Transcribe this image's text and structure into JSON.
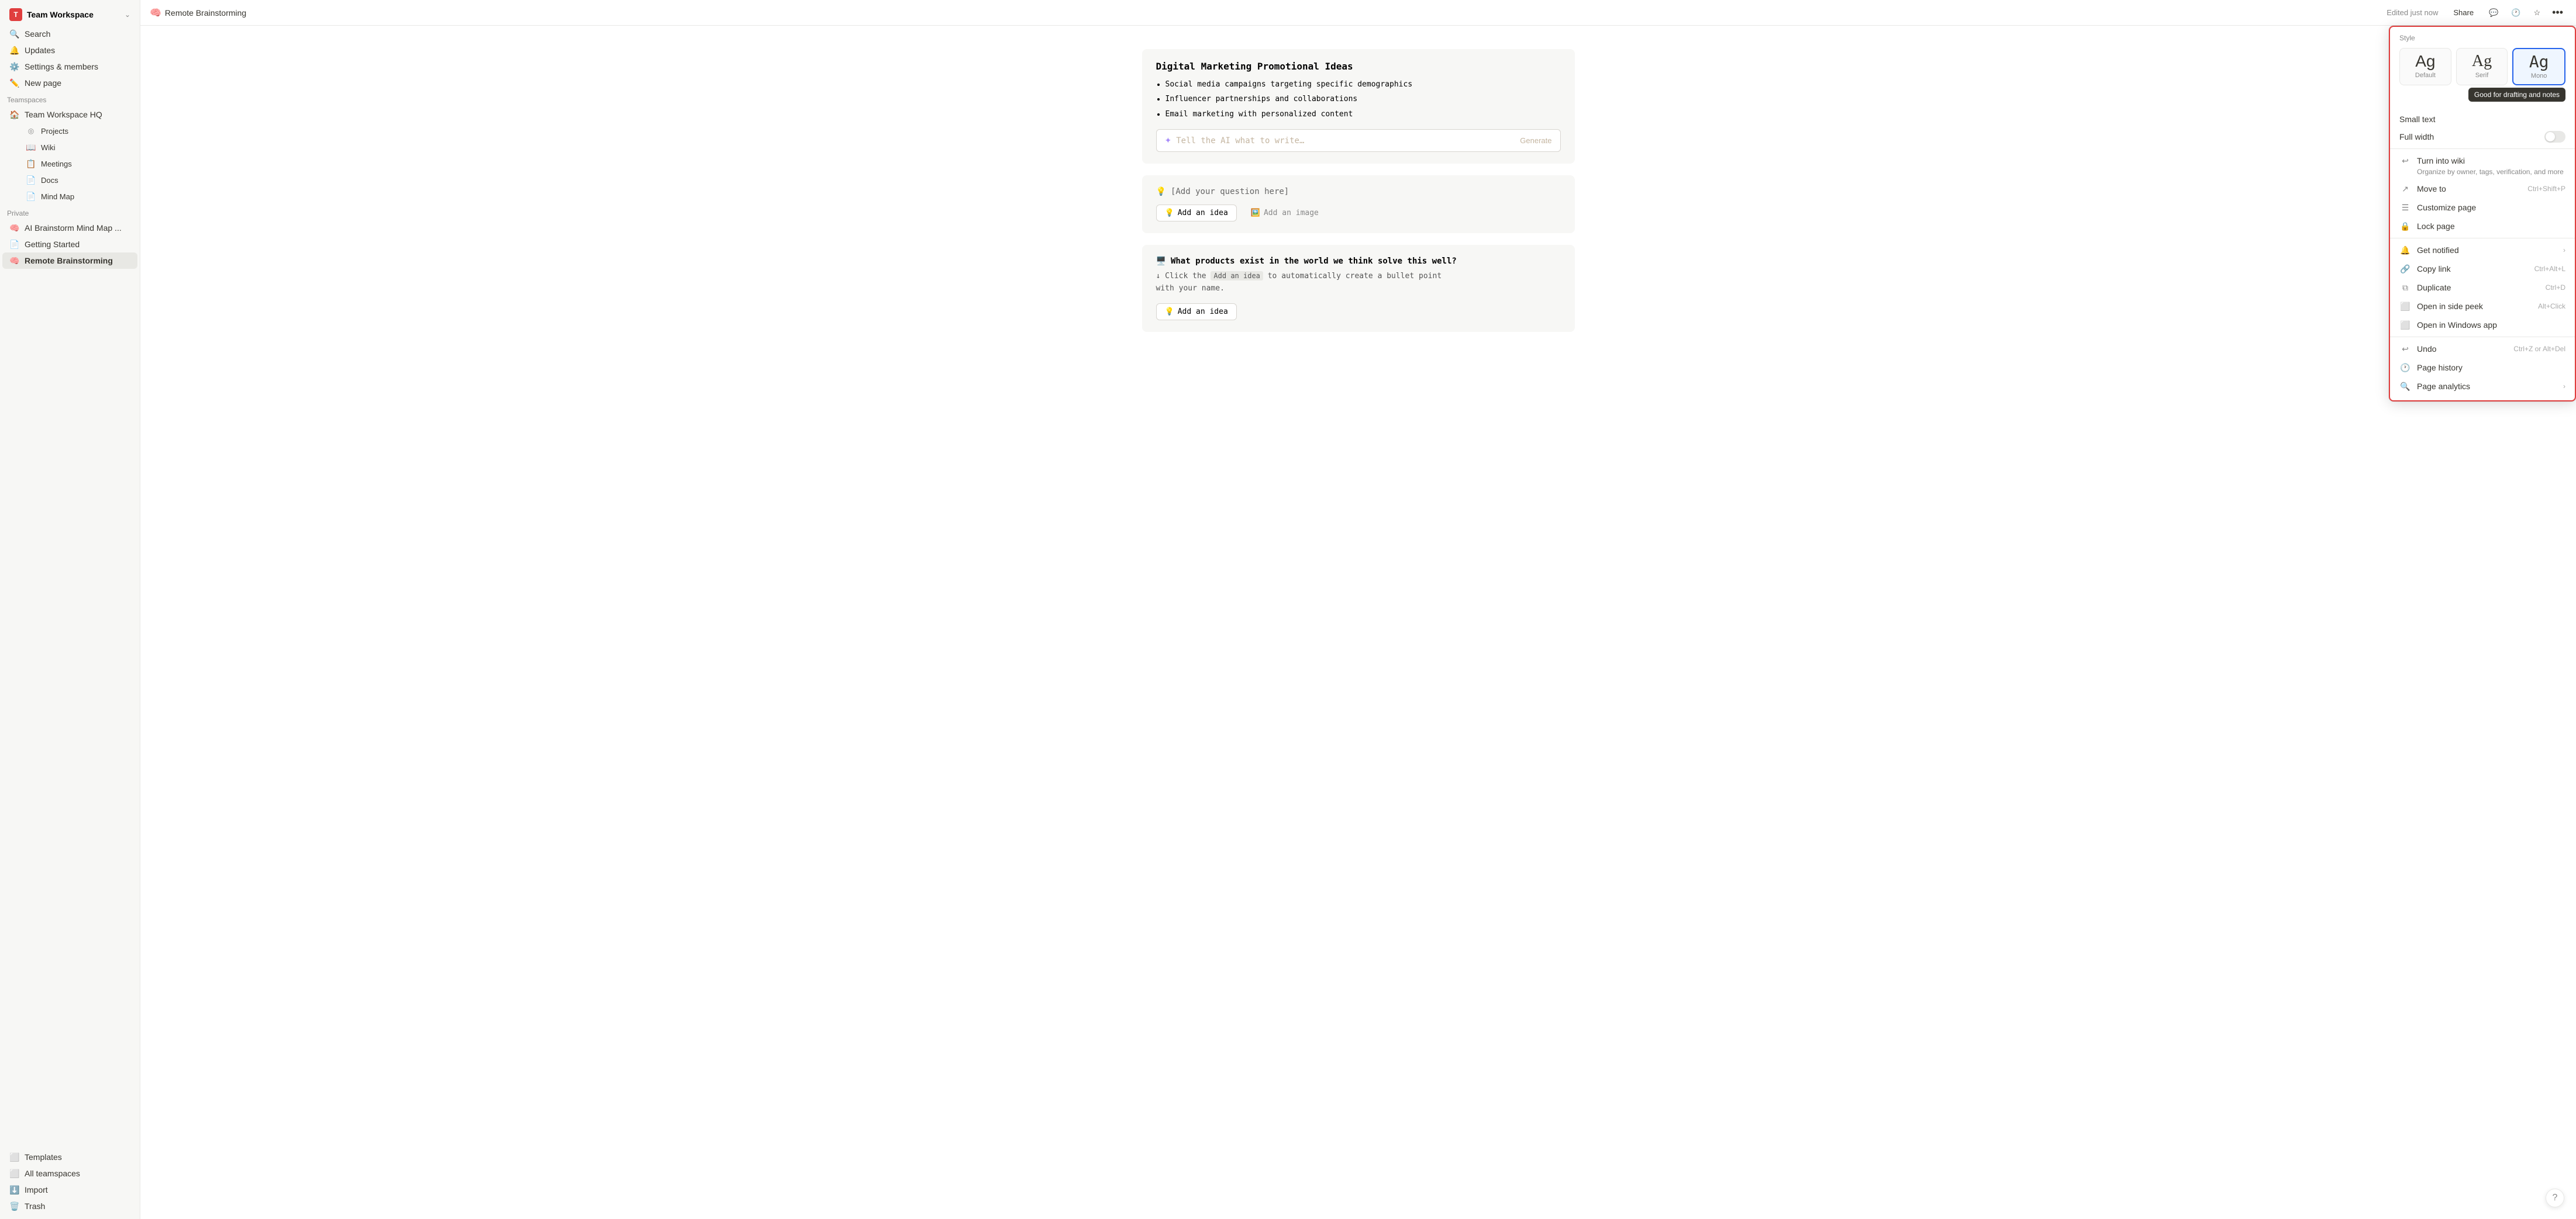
{
  "sidebar": {
    "workspace": {
      "icon": "T",
      "name": "Team Workspace",
      "chevron": "⌄"
    },
    "top_items": [
      {
        "id": "search",
        "label": "Search",
        "icon": "🔍"
      },
      {
        "id": "updates",
        "label": "Updates",
        "icon": "🔔"
      },
      {
        "id": "settings",
        "label": "Settings & members",
        "icon": "⚙️"
      },
      {
        "id": "new-page",
        "label": "New page",
        "icon": "✏️"
      }
    ],
    "teamspaces_label": "Teamspaces",
    "teamspaces": [
      {
        "id": "team-hq",
        "label": "Team Workspace HQ",
        "icon": "🏠",
        "emoji": true
      }
    ],
    "teamspace_sub": [
      {
        "id": "projects",
        "label": "Projects",
        "icon": "◎"
      },
      {
        "id": "wiki",
        "label": "Wiki",
        "icon": "📖"
      },
      {
        "id": "meetings",
        "label": "Meetings",
        "icon": "📋"
      },
      {
        "id": "docs",
        "label": "Docs",
        "icon": "📄"
      },
      {
        "id": "mind-map",
        "label": "Mind Map",
        "icon": "📄"
      }
    ],
    "private_label": "Private",
    "private_items": [
      {
        "id": "ai-brainstorm",
        "label": "AI Brainstorm Mind Map ...",
        "icon": "🧠"
      },
      {
        "id": "getting-started",
        "label": "Getting Started",
        "icon": "📄"
      },
      {
        "id": "remote-brainstorming",
        "label": "Remote Brainstorming",
        "icon": "🧠",
        "active": true
      }
    ],
    "bottom_items": [
      {
        "id": "templates",
        "label": "Templates",
        "icon": "⬜"
      },
      {
        "id": "all-teamspaces",
        "label": "All teamspaces",
        "icon": "⬜"
      },
      {
        "id": "import",
        "label": "Import",
        "icon": "⬇️"
      },
      {
        "id": "trash",
        "label": "Trash",
        "icon": "🗑️"
      }
    ]
  },
  "topbar": {
    "page_icon": "🧠",
    "page_title": "Remote Brainstorming",
    "edited_text": "Edited just now",
    "share_label": "Share",
    "dots_label": "•••"
  },
  "content": {
    "block1": {
      "title": "Digital Marketing Promotional Ideas",
      "bullets": [
        "Social media campaigns targeting specific demographics",
        "Influencer partnerships and collaborations",
        "Email marketing with personalized content"
      ],
      "ai_placeholder": "Tell the AI what to write…",
      "ai_generate": "Generate"
    },
    "block2": {
      "question_icon": "💡",
      "question_text": "[Add your question here]",
      "add_idea_label": "Add an idea",
      "add_image_label": "Add an image"
    },
    "block3": {
      "icon": "🖥️",
      "title": "What products exist in the world we think solve this well?",
      "desc_prefix": "↓ Click the",
      "desc_inline": "Add an idea",
      "desc_suffix": "to automatically create a bullet point\nwith your name.",
      "add_idea_label": "Add an idea"
    }
  },
  "dropdown": {
    "style_label": "Style",
    "styles": [
      {
        "id": "default",
        "label": "Default",
        "ag": "Ag",
        "class": "default",
        "active": false
      },
      {
        "id": "serif",
        "label": "Serif",
        "ag": "Ag",
        "class": "serif",
        "active": false
      },
      {
        "id": "mono",
        "label": "Mono",
        "ag": "Ag",
        "class": "mono",
        "active": true
      }
    ],
    "tooltip": "Good for drafting and notes",
    "small_text_label": "Small text",
    "full_width_label": "Full width",
    "full_width_on": false,
    "menu_items": [
      {
        "id": "turn-into-wiki",
        "icon": "↩",
        "label": "Turn into wiki",
        "desc": "Organize by owner, tags,\nverification, and more",
        "shortcut": "",
        "chevron": false,
        "is_wiki": true
      },
      {
        "id": "move-to",
        "icon": "↗",
        "label": "Move to",
        "shortcut": "Ctrl+Shift+P",
        "chevron": false
      },
      {
        "id": "customize-page",
        "icon": "☰",
        "label": "Customize page",
        "shortcut": "",
        "chevron": false
      },
      {
        "id": "lock-page",
        "icon": "🔒",
        "label": "Lock page",
        "shortcut": "",
        "chevron": false
      },
      {
        "id": "get-notified",
        "icon": "🔔",
        "label": "Get notified",
        "shortcut": "",
        "chevron": true
      },
      {
        "id": "copy-link",
        "icon": "🔗",
        "label": "Copy link",
        "shortcut": "Ctrl+Alt+L",
        "chevron": false
      },
      {
        "id": "duplicate",
        "icon": "⧉",
        "label": "Duplicate",
        "shortcut": "Ctrl+D",
        "chevron": false
      },
      {
        "id": "open-side-peek",
        "icon": "⬜",
        "label": "Open in side peek",
        "shortcut": "Alt+Click",
        "chevron": false
      },
      {
        "id": "open-windows",
        "icon": "⬜",
        "label": "Open in Windows app",
        "shortcut": "",
        "chevron": false
      },
      {
        "id": "undo",
        "icon": "↩",
        "label": "Undo",
        "shortcut": "Ctrl+Z or Alt+Del",
        "chevron": false
      },
      {
        "id": "page-history",
        "icon": "🕐",
        "label": "Page history",
        "shortcut": "",
        "chevron": false
      },
      {
        "id": "page-analytics",
        "icon": "🔍",
        "label": "Page analytics",
        "shortcut": "",
        "chevron": true
      }
    ]
  },
  "help": {
    "label": "?"
  }
}
